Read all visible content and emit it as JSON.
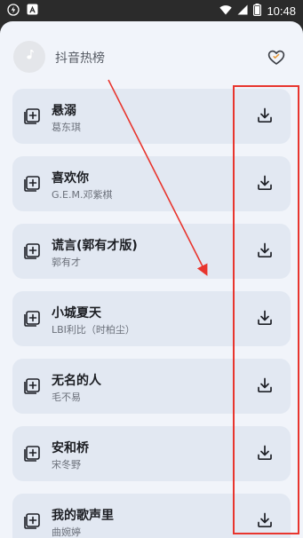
{
  "status_bar": {
    "time": "10:48",
    "left_icons": [
      "flash-icon",
      "notification-icon"
    ],
    "right_icons": [
      "wifi-icon",
      "signal-icon",
      "battery-icon"
    ]
  },
  "header": {
    "title": "抖音热榜",
    "avatar_icon": "music-note-icon",
    "favorite_icon": "heart-icon"
  },
  "songs": [
    {
      "title": "悬溺",
      "artist": "葛东琪"
    },
    {
      "title": "喜欢你",
      "artist": "G.E.M.邓紫棋"
    },
    {
      "title": "谎言(郭有才版)",
      "artist": "郭有才"
    },
    {
      "title": "小城夏天",
      "artist": "LBI利比（时柏尘）"
    },
    {
      "title": "无名的人",
      "artist": "毛不易"
    },
    {
      "title": "安和桥",
      "artist": "宋冬野"
    },
    {
      "title": "我的歌声里",
      "artist": "曲婉婷"
    }
  ],
  "icons": {
    "add": "add-to-playlist-icon",
    "download": "download-icon"
  },
  "colors": {
    "annotation": "#e8352e",
    "card": "#e2e8f2",
    "sheet": "#f1f4fa",
    "status_bar": "#2b2b2b"
  }
}
